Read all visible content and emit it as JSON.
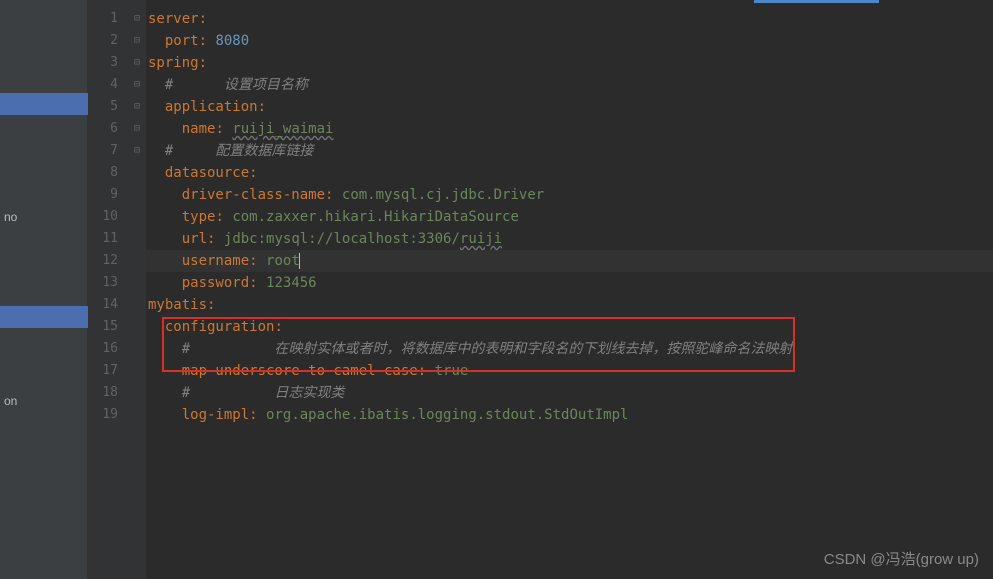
{
  "sidebar": {
    "items": [
      "no",
      "on"
    ]
  },
  "gutter": {
    "lines": [
      "1",
      "2",
      "3",
      "4",
      "5",
      "6",
      "7",
      "8",
      "9",
      "10",
      "11",
      "12",
      "13",
      "14",
      "15",
      "16",
      "17",
      "18",
      "19"
    ]
  },
  "fold": [
    "⊟",
    "⊟",
    "⊟",
    "",
    "",
    "⊟",
    "",
    "⊟",
    "",
    "",
    "",
    "",
    "",
    "⊟",
    "⊟",
    "",
    "",
    "",
    ""
  ],
  "code": {
    "l1_key": "server",
    "l2_key": "port",
    "l2_val": "8080",
    "l3_key": "spring",
    "l4_comment": "#      设置项目名称",
    "l5_key": "application",
    "l6_key": "name",
    "l6_val": "ruiji_waimai",
    "l7_comment": "#     配置数据库链接",
    "l8_key": "datasource",
    "l9_key": "driver-class-name",
    "l9_val": "com.mysql.cj.jdbc.Driver",
    "l10_key": "type",
    "l10_val": "com.zaxxer.hikari.HikariDataSource",
    "l11_key": "url",
    "l11_val_a": "jdbc:mysql://localhost:3306/",
    "l11_val_b": "ruiji",
    "l12_key": "username",
    "l12_val": "root",
    "l13_key": "password",
    "l13_val": "123456",
    "l14_key": "mybatis",
    "l15_key": "configuration",
    "l16_comment": "#          在映射实体或者时，将数据库中的表明和字段名的下划线去掉，按照驼峰命名法映射",
    "l17_key": "map-underscore-to-camel-case",
    "l17_val": "true",
    "l18_comment": "#          日志实现类",
    "l19_key": "log-impl",
    "l19_val": "org.apache.ibatis.logging.stdout.StdOutImpl"
  },
  "watermark": "CSDN @冯浩(grow up)"
}
